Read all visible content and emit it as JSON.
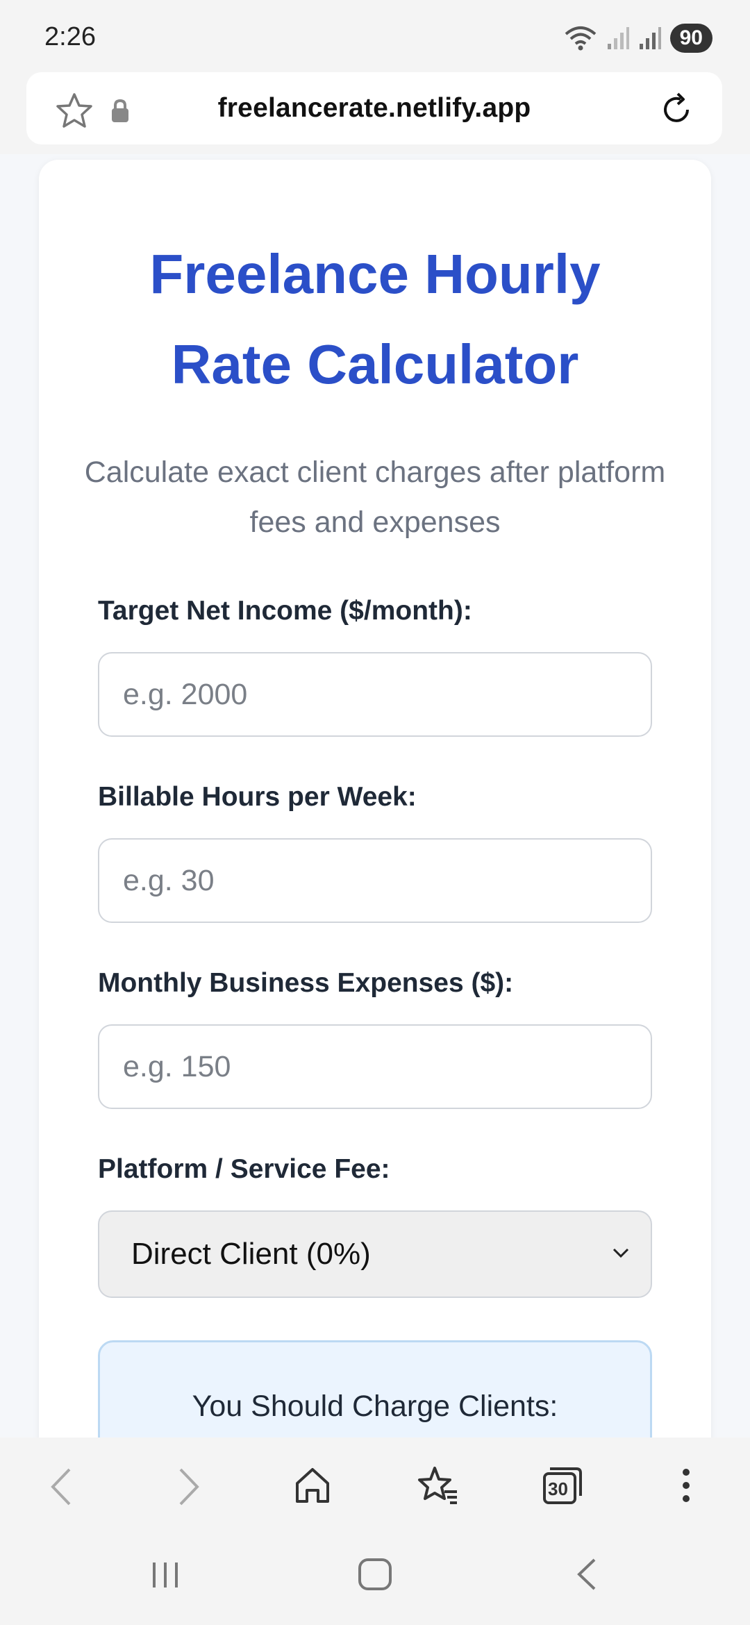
{
  "status_bar": {
    "time": "2:26",
    "battery": "90"
  },
  "browser": {
    "url": "freelancerate.netlify.app"
  },
  "page": {
    "title_line1": "Freelance Hourly",
    "title_line2": "Rate Calculator",
    "subtitle": "Calculate exact client charges after platform fees and expenses",
    "fields": [
      {
        "label": "Target Net Income ($/month):",
        "placeholder": "e.g. 2000",
        "value": ""
      },
      {
        "label": "Billable Hours per Week:",
        "placeholder": "e.g. 30",
        "value": ""
      },
      {
        "label": "Monthly Business Expenses ($):",
        "placeholder": "e.g. 150",
        "value": ""
      }
    ],
    "platform_fee": {
      "label": "Platform / Service Fee:",
      "selected": "Direct Client (0%)"
    },
    "result": {
      "label": "You Should Charge Clients:"
    }
  },
  "toolbar": {
    "tabs_count": "30"
  },
  "colors": {
    "title": "#2b4fc8",
    "result_bg": "#ebf4fe",
    "result_border": "#bcd9f3"
  },
  "icons": [
    "star-icon",
    "lock-icon",
    "reload-icon",
    "back-icon",
    "forward-icon",
    "home-icon",
    "bookmarks-icon",
    "tabs-icon",
    "more-icon",
    "recents-icon",
    "home-nav-icon",
    "back-nav-icon",
    "wifi-icon",
    "signal-icon"
  ]
}
